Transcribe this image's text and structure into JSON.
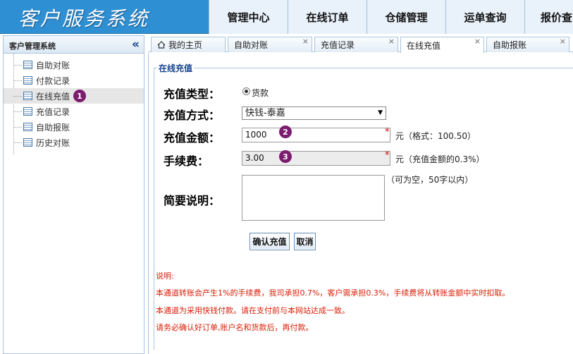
{
  "header": {
    "title": "客户服务系统",
    "nav": [
      "管理中心",
      "在线订单",
      "仓储管理",
      "运单查询",
      "报价查"
    ]
  },
  "sidebar": {
    "title": "客户管理系统",
    "items": [
      {
        "label": "自助对账",
        "selected": false
      },
      {
        "label": "付款记录",
        "selected": false
      },
      {
        "label": "在线充值",
        "selected": true,
        "marker": "1"
      },
      {
        "label": "充值记录",
        "selected": false
      },
      {
        "label": "自助报账",
        "selected": false
      },
      {
        "label": "历史对账",
        "selected": false
      }
    ]
  },
  "tabs": [
    {
      "label": "我的主页",
      "closable": false,
      "active": false
    },
    {
      "label": "自助对账",
      "closable": true,
      "active": false
    },
    {
      "label": "充值记录",
      "closable": true,
      "active": false
    },
    {
      "label": "在线充值",
      "closable": true,
      "active": true
    },
    {
      "label": "自助报账",
      "closable": true,
      "active": false
    }
  ],
  "close_glyph": "×",
  "form": {
    "legend": "在线充值",
    "recharge_type": {
      "label": "充值类型：",
      "option": "货款"
    },
    "recharge_method": {
      "label": "充值方式：",
      "value": "快钱-泰嘉"
    },
    "amount": {
      "label": "充值金额：",
      "value": "1000",
      "required": "*",
      "hint": "元（格式：100.50）",
      "marker": "2"
    },
    "fee": {
      "label": "手续费：",
      "value": "3.00",
      "required": "*",
      "hint": "元（充值金额的0.3%）",
      "marker": "3"
    },
    "description": {
      "label": "简要说明：",
      "hint": "（可为空，50字以内）"
    },
    "confirm_label": "确认充值",
    "cancel_label": "取消"
  },
  "notes": [
    "说明:",
    "本通道转账会产生1%的手续费，我司承担0.7%，客户需承担0.3%，手续费将从转账金额中实时扣取。",
    "本通道为采用快钱付款。请在支付前与本网站达成一致。",
    "请务必确认好订单,账户名和货款后，再付款。"
  ],
  "colors": {
    "header": "#2f8fd3",
    "marker": "#7b1c6e",
    "notes": "#d81e06"
  }
}
